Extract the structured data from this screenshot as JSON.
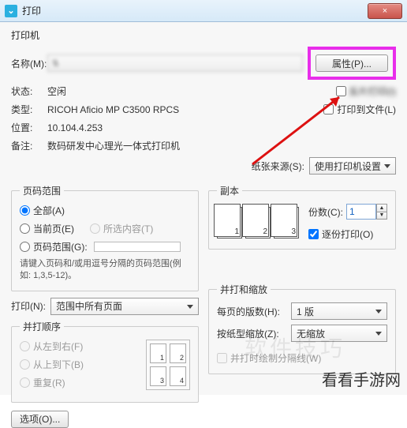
{
  "window": {
    "title": "打印",
    "closeLabel": "×"
  },
  "printer": {
    "section": "打印机",
    "labels": {
      "name": "名称(M):",
      "status": "状态:",
      "type": "类型:",
      "where": "位置:",
      "comment": "备注:"
    },
    "name_value": "\\\\",
    "status_value": "空闲",
    "type_value": "RICOH Aficio MP C3500 RPCS",
    "where_value": "10.104.4.253",
    "comment_value": "数码研发中心理光一体式打印机",
    "propertiesBtn": "属性(P)...",
    "reversePrint": "反片打印(I)",
    "printToFile": "打印到文件(L)",
    "paperSourceLabel": "纸张来源(S):",
    "paperSourceValue": "使用打印机设置"
  },
  "range": {
    "legend": "页码范围",
    "all": "全部(A)",
    "current": "当前页(E)",
    "selection": "所选内容(T)",
    "pages": "页码范围(G):",
    "hint": "请键入页码和/或用逗号分隔的页码范围(例如: 1,3,5-12)。",
    "printLabel": "打印(N):",
    "printValue": "范围中所有页面"
  },
  "copies": {
    "legend": "副本",
    "copiesLabel": "份数(C):",
    "copiesValue": "1",
    "collate": "逐份打印(O)"
  },
  "order": {
    "legend": "并打顺序",
    "ltr": "从左到右(F)",
    "ttb": "从上到下(B)",
    "repeat": "重复(R)"
  },
  "scale": {
    "legend": "并打和缩放",
    "pagesPerSheetLabel": "每页的版数(H):",
    "pagesPerSheetValue": "1 版",
    "scaleToPaperLabel": "按纸型缩放(Z):",
    "scaleToPaperValue": "无缩放",
    "drawBorder": "并打时绘制分隔线(W)"
  },
  "footer": {
    "options": "选项(O)..."
  },
  "watermarks": {
    "faint": "软件技巧",
    "brand": "看看手游网"
  }
}
